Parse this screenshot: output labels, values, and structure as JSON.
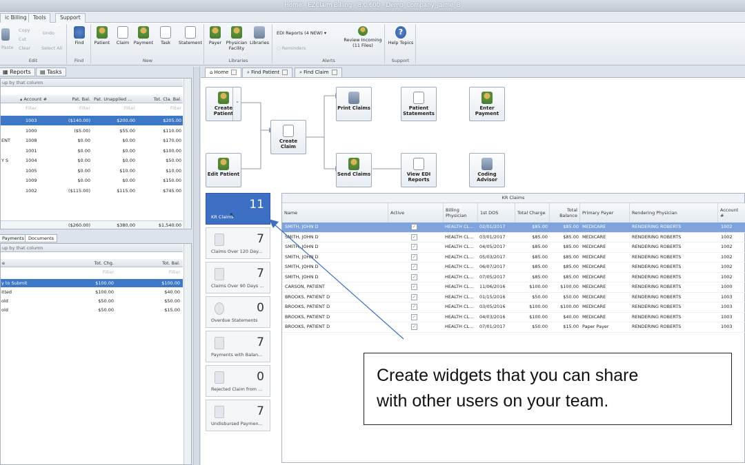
{
  "window": {
    "title": "Home - EZClaim Billing - 8.0.600 - Demo_Company_Jaime_B"
  },
  "menu_tabs": [
    "ic Billing",
    "Tools",
    "Support"
  ],
  "ribbon": {
    "edit": {
      "label": "Edit",
      "copy": "Copy",
      "cut": "Cut",
      "clear": "Clear",
      "undo": "Undo",
      "select_all": "Select All",
      "paste": "Paste"
    },
    "find": {
      "label": "Find",
      "find": "Find"
    },
    "new": {
      "label": "New",
      "items": [
        "Patient",
        "Claim",
        "Payment",
        "Task",
        "Statement"
      ]
    },
    "libraries": {
      "label": "Libraries",
      "items": [
        "Payer",
        "Physician Facility",
        "Libraries"
      ]
    },
    "alerts": {
      "label": "Alerts",
      "edi_reports": "EDI Reports (4 NEW)",
      "reminders": "Reminders",
      "review_incoming": "Review Incoming (11 Files)"
    },
    "support": {
      "label": "Support",
      "help": "Help Topics"
    }
  },
  "left_tabs": {
    "reports": "Reports",
    "tasks": "Tasks"
  },
  "patient_grid": {
    "group_hint": "up by that column",
    "columns": [
      "Account #",
      "Pat. Bal.",
      "Pat. Unapplied ...",
      "Tot. Cla. Bal."
    ],
    "filter": "Filter",
    "rows": [
      {
        "name": "",
        "acct": "1003",
        "bal": "($140.00)",
        "unapplied": "$200.00",
        "tot": "$205.00"
      },
      {
        "name": "",
        "acct": "1000",
        "bal": "($5.00)",
        "unapplied": "$55.00",
        "tot": "$110.00"
      },
      {
        "name": "ENT",
        "acct": "1008",
        "bal": "$0.00",
        "unapplied": "$0.00",
        "tot": "$170.00"
      },
      {
        "name": "",
        "acct": "1001",
        "bal": "$0.00",
        "unapplied": "$0.00",
        "tot": "$100.00"
      },
      {
        "name": "Y S",
        "acct": "1004",
        "bal": "$0.00",
        "unapplied": "$0.00",
        "tot": "$50.00"
      },
      {
        "name": "",
        "acct": "1005",
        "bal": "$0.00",
        "unapplied": "$10.00",
        "tot": "$10.00"
      },
      {
        "name": "",
        "acct": "1009",
        "bal": "$0.00",
        "unapplied": "$0.00",
        "tot": "$150.00"
      },
      {
        "name": "",
        "acct": "1002",
        "bal": "($115.00)",
        "unapplied": "$115.00",
        "tot": "$745.00"
      }
    ],
    "totals": {
      "bal": "($260.00)",
      "unapplied": "$380.00",
      "tot": "$1,540.00"
    }
  },
  "claim_grid": {
    "tabs": [
      "Payments",
      "Documents"
    ],
    "group_hint": "up by that column",
    "columns": [
      "Tot. Chg.",
      "Tot. Bal."
    ],
    "filter": "Filter",
    "rows": [
      {
        "status": "y to Submit",
        "chg": "$100.00",
        "bal": "$100.00"
      },
      {
        "status": "itted",
        "chg": "$100.00",
        "bal": "$40.00"
      },
      {
        "status": "old",
        "chg": "$50.00",
        "bal": "$50.00"
      },
      {
        "status": "old",
        "chg": "$50.00",
        "bal": "$15.00"
      }
    ]
  },
  "doc_tabs": [
    "Home",
    "Find Patient",
    "Find Claim"
  ],
  "workflow": {
    "create_patient": "Create Patient",
    "edit_patient": "Edit Patient",
    "create_claim": "Create Claim",
    "print_claims": "Print Claims",
    "patient_statements": "Patient Statements",
    "enter_payment": "Enter Payment",
    "send_claims": "Send Claims",
    "view_edi_reports": "View EDI Reports",
    "coding_advisor": "Coding Advisor"
  },
  "widgets": [
    {
      "count": "11",
      "label": "KR Claims"
    },
    {
      "count": "7",
      "label": "Claims Over 120 Day..."
    },
    {
      "count": "7",
      "label": "Claims Over 90 Days ..."
    },
    {
      "count": "0",
      "label": "Overdue Statements"
    },
    {
      "count": "7",
      "label": "Payments with Balan..."
    },
    {
      "count": "0",
      "label": "Rejected Claim from ..."
    },
    {
      "count": "7",
      "label": "Undisbursed Paymen..."
    }
  ],
  "kr_grid": {
    "title": "KR Claims",
    "columns": [
      "Name",
      "Active",
      "Billing Physician",
      "1st DOS",
      "Total Charge",
      "Total Balance",
      "Primary Payer",
      "Rendering Physician",
      "Account #"
    ],
    "rows": [
      {
        "name": "SMITH, JOHN D",
        "phys": "HEALTH CL...",
        "dos": "02/01/2017",
        "chg": "$85.00",
        "bal": "$85.00",
        "payer": "MEDICARE",
        "rend": "RENDERING ROBERTS",
        "acct": "1002"
      },
      {
        "name": "SMITH, JOHN D",
        "phys": "HEALTH CL...",
        "dos": "03/01/2017",
        "chg": "$85.00",
        "bal": "$85.00",
        "payer": "MEDICARE",
        "rend": "RENDERING ROBERTS",
        "acct": "1002"
      },
      {
        "name": "SMITH, JOHN D",
        "phys": "HEALTH CL...",
        "dos": "04/05/2017",
        "chg": "$85.00",
        "bal": "$85.00",
        "payer": "MEDICARE",
        "rend": "RENDERING ROBERTS",
        "acct": "1002"
      },
      {
        "name": "SMITH, JOHN D",
        "phys": "HEALTH CL...",
        "dos": "05/03/2017",
        "chg": "$85.00",
        "bal": "$85.00",
        "payer": "MEDICARE",
        "rend": "RENDERING ROBERTS",
        "acct": "1002"
      },
      {
        "name": "SMITH, JOHN D",
        "phys": "HEALTH CL...",
        "dos": "06/07/2017",
        "chg": "$85.00",
        "bal": "$85.00",
        "payer": "MEDICARE",
        "rend": "RENDERING ROBERTS",
        "acct": "1002"
      },
      {
        "name": "SMITH, JOHN D",
        "phys": "HEALTH CL...",
        "dos": "07/05/2017",
        "chg": "$85.00",
        "bal": "$85.00",
        "payer": "MEDICARE",
        "rend": "RENDERING ROBERTS",
        "acct": "1002"
      },
      {
        "name": "CARSON, PATIENT",
        "phys": "HEALTH CL...",
        "dos": "11/06/2016",
        "chg": "$100.00",
        "bal": "$100.00",
        "payer": "MEDICARE",
        "rend": "RENDERING ROBERTS",
        "acct": "1000"
      },
      {
        "name": "BROOKS, PATIENT D",
        "phys": "HEALTH CL...",
        "dos": "01/15/2016",
        "chg": "$50.00",
        "bal": "$50.00",
        "payer": "MEDICARE",
        "rend": "RENDERING ROBERTS",
        "acct": "1003"
      },
      {
        "name": "BROOKS, PATIENT D",
        "phys": "HEALTH CL...",
        "dos": "03/05/2016",
        "chg": "$100.00",
        "bal": "$100.00",
        "payer": "MEDICARE",
        "rend": "RENDERING ROBERTS",
        "acct": "1003"
      },
      {
        "name": "BROOKS, PATIENT D",
        "phys": "HEALTH CL...",
        "dos": "04/03/2016",
        "chg": "$100.00",
        "bal": "$40.00",
        "payer": "MEDICARE",
        "rend": "RENDERING ROBERTS",
        "acct": "1003"
      },
      {
        "name": "BROOKS, PATIENT D",
        "phys": "HEALTH CL...",
        "dos": "07/01/2017",
        "chg": "$50.00",
        "bal": "$15.00",
        "payer": "Paper Payer",
        "rend": "RENDERING ROBERTS",
        "acct": "1003"
      }
    ]
  },
  "callout": {
    "line1": "Create widgets that you can share",
    "line2": "with other users on your team."
  }
}
